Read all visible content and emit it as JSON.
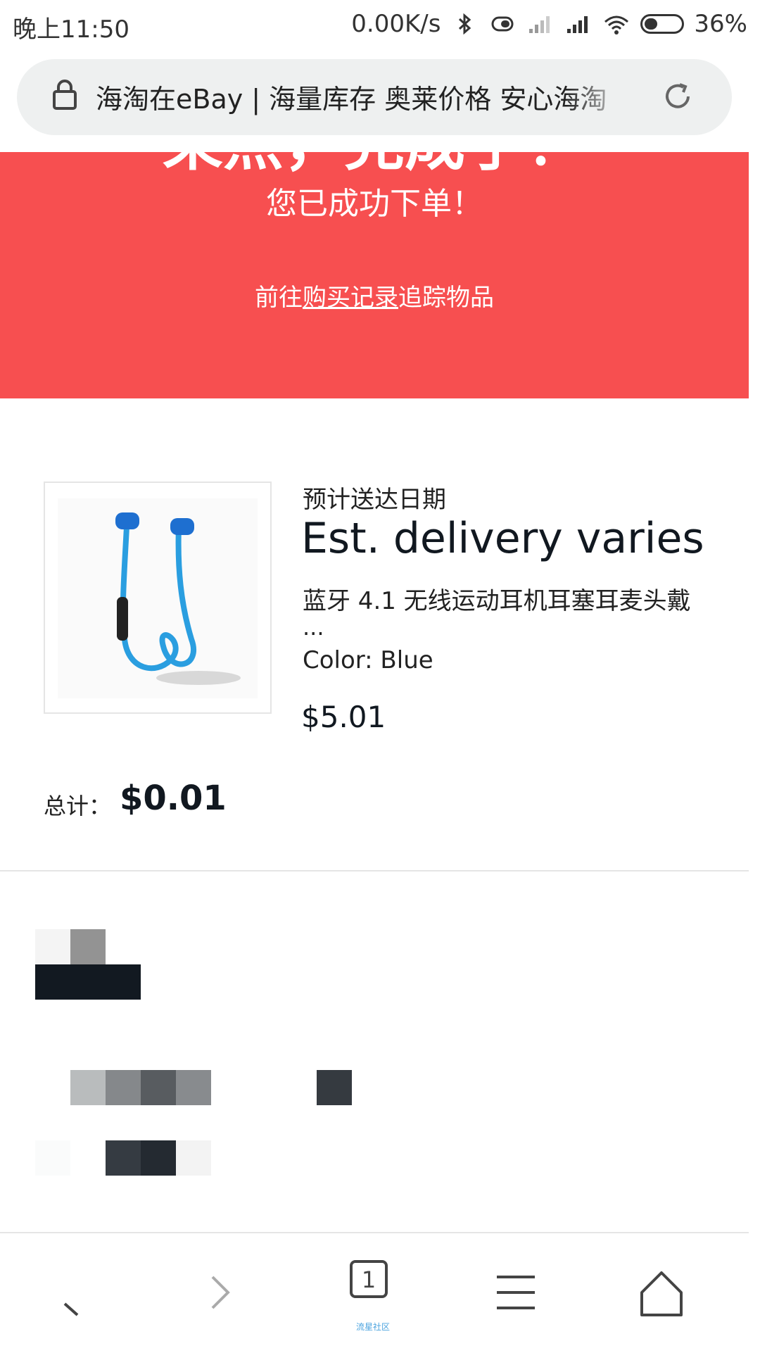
{
  "status_bar": {
    "time": "晚上11:50",
    "network_speed": "0.00K/s",
    "battery_percent": "36%",
    "icons": [
      "bluetooth-icon",
      "vibrate-icon",
      "signal-icon",
      "signal-icon",
      "wifi-icon",
      "battery-icon"
    ]
  },
  "url_bar": {
    "title": "海淘在eBay | 海量库存 奥莱价格 安心海淘"
  },
  "banner": {
    "heading": "呆点，完成了！",
    "subheading": "您已成功下单！",
    "link_prefix": "前往",
    "link_text": "购买记录",
    "link_suffix": "追踪物品",
    "color": "#f74f50"
  },
  "order": {
    "eta_label": "预计送达日期",
    "eta_value": "Est. delivery varies",
    "product_title": "蓝牙 4.1 无线运动耳机耳塞耳麦头戴",
    "product_ellipsis": "...",
    "product_color": "Color: Blue",
    "product_price": "$5.01",
    "total_label": "总计：",
    "total_value": "$0.01"
  },
  "bottom_nav": {
    "tab_count": "1",
    "watermark": "流星社区"
  }
}
